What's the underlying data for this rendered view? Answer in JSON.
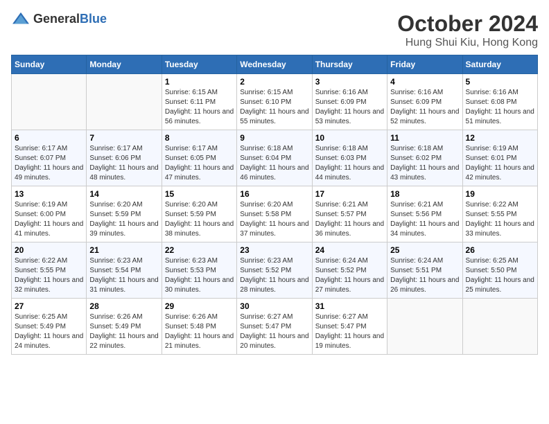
{
  "header": {
    "logo_general": "General",
    "logo_blue": "Blue",
    "month": "October 2024",
    "location": "Hung Shui Kiu, Hong Kong"
  },
  "weekdays": [
    "Sunday",
    "Monday",
    "Tuesday",
    "Wednesday",
    "Thursday",
    "Friday",
    "Saturday"
  ],
  "weeks": [
    [
      {
        "day": "",
        "info": ""
      },
      {
        "day": "",
        "info": ""
      },
      {
        "day": "1",
        "info": "Sunrise: 6:15 AM\nSunset: 6:11 PM\nDaylight: 11 hours and 56 minutes."
      },
      {
        "day": "2",
        "info": "Sunrise: 6:15 AM\nSunset: 6:10 PM\nDaylight: 11 hours and 55 minutes."
      },
      {
        "day": "3",
        "info": "Sunrise: 6:16 AM\nSunset: 6:09 PM\nDaylight: 11 hours and 53 minutes."
      },
      {
        "day": "4",
        "info": "Sunrise: 6:16 AM\nSunset: 6:09 PM\nDaylight: 11 hours and 52 minutes."
      },
      {
        "day": "5",
        "info": "Sunrise: 6:16 AM\nSunset: 6:08 PM\nDaylight: 11 hours and 51 minutes."
      }
    ],
    [
      {
        "day": "6",
        "info": "Sunrise: 6:17 AM\nSunset: 6:07 PM\nDaylight: 11 hours and 49 minutes."
      },
      {
        "day": "7",
        "info": "Sunrise: 6:17 AM\nSunset: 6:06 PM\nDaylight: 11 hours and 48 minutes."
      },
      {
        "day": "8",
        "info": "Sunrise: 6:17 AM\nSunset: 6:05 PM\nDaylight: 11 hours and 47 minutes."
      },
      {
        "day": "9",
        "info": "Sunrise: 6:18 AM\nSunset: 6:04 PM\nDaylight: 11 hours and 46 minutes."
      },
      {
        "day": "10",
        "info": "Sunrise: 6:18 AM\nSunset: 6:03 PM\nDaylight: 11 hours and 44 minutes."
      },
      {
        "day": "11",
        "info": "Sunrise: 6:18 AM\nSunset: 6:02 PM\nDaylight: 11 hours and 43 minutes."
      },
      {
        "day": "12",
        "info": "Sunrise: 6:19 AM\nSunset: 6:01 PM\nDaylight: 11 hours and 42 minutes."
      }
    ],
    [
      {
        "day": "13",
        "info": "Sunrise: 6:19 AM\nSunset: 6:00 PM\nDaylight: 11 hours and 41 minutes."
      },
      {
        "day": "14",
        "info": "Sunrise: 6:20 AM\nSunset: 5:59 PM\nDaylight: 11 hours and 39 minutes."
      },
      {
        "day": "15",
        "info": "Sunrise: 6:20 AM\nSunset: 5:59 PM\nDaylight: 11 hours and 38 minutes."
      },
      {
        "day": "16",
        "info": "Sunrise: 6:20 AM\nSunset: 5:58 PM\nDaylight: 11 hours and 37 minutes."
      },
      {
        "day": "17",
        "info": "Sunrise: 6:21 AM\nSunset: 5:57 PM\nDaylight: 11 hours and 36 minutes."
      },
      {
        "day": "18",
        "info": "Sunrise: 6:21 AM\nSunset: 5:56 PM\nDaylight: 11 hours and 34 minutes."
      },
      {
        "day": "19",
        "info": "Sunrise: 6:22 AM\nSunset: 5:55 PM\nDaylight: 11 hours and 33 minutes."
      }
    ],
    [
      {
        "day": "20",
        "info": "Sunrise: 6:22 AM\nSunset: 5:55 PM\nDaylight: 11 hours and 32 minutes."
      },
      {
        "day": "21",
        "info": "Sunrise: 6:23 AM\nSunset: 5:54 PM\nDaylight: 11 hours and 31 minutes."
      },
      {
        "day": "22",
        "info": "Sunrise: 6:23 AM\nSunset: 5:53 PM\nDaylight: 11 hours and 30 minutes."
      },
      {
        "day": "23",
        "info": "Sunrise: 6:23 AM\nSunset: 5:52 PM\nDaylight: 11 hours and 28 minutes."
      },
      {
        "day": "24",
        "info": "Sunrise: 6:24 AM\nSunset: 5:52 PM\nDaylight: 11 hours and 27 minutes."
      },
      {
        "day": "25",
        "info": "Sunrise: 6:24 AM\nSunset: 5:51 PM\nDaylight: 11 hours and 26 minutes."
      },
      {
        "day": "26",
        "info": "Sunrise: 6:25 AM\nSunset: 5:50 PM\nDaylight: 11 hours and 25 minutes."
      }
    ],
    [
      {
        "day": "27",
        "info": "Sunrise: 6:25 AM\nSunset: 5:49 PM\nDaylight: 11 hours and 24 minutes."
      },
      {
        "day": "28",
        "info": "Sunrise: 6:26 AM\nSunset: 5:49 PM\nDaylight: 11 hours and 22 minutes."
      },
      {
        "day": "29",
        "info": "Sunrise: 6:26 AM\nSunset: 5:48 PM\nDaylight: 11 hours and 21 minutes."
      },
      {
        "day": "30",
        "info": "Sunrise: 6:27 AM\nSunset: 5:47 PM\nDaylight: 11 hours and 20 minutes."
      },
      {
        "day": "31",
        "info": "Sunrise: 6:27 AM\nSunset: 5:47 PM\nDaylight: 11 hours and 19 minutes."
      },
      {
        "day": "",
        "info": ""
      },
      {
        "day": "",
        "info": ""
      }
    ]
  ]
}
